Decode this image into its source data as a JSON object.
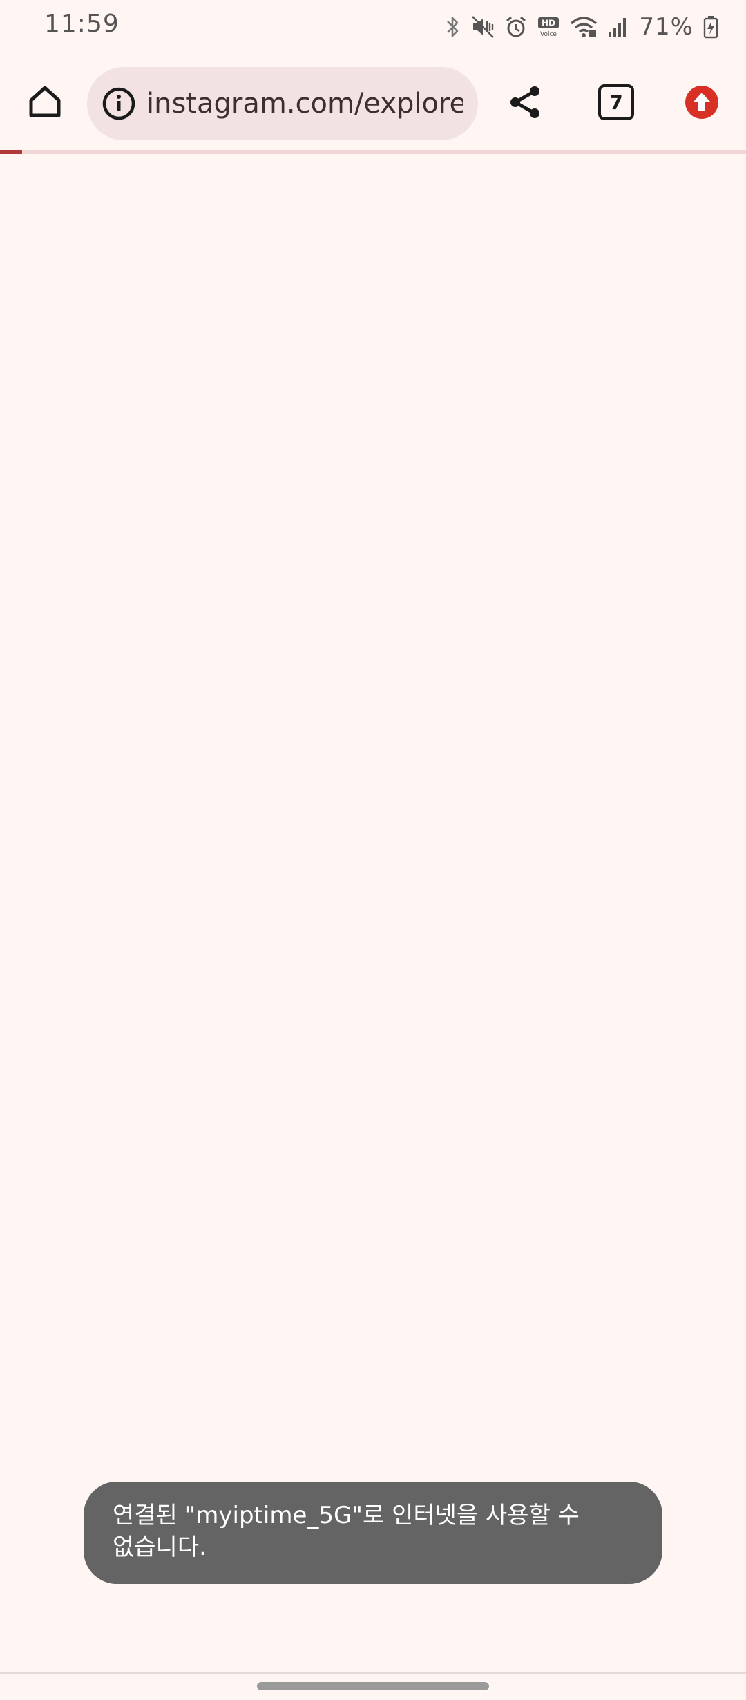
{
  "status_bar": {
    "time": "11:59",
    "battery_percent": "71%",
    "icons": [
      "bluetooth-icon",
      "mute-vibrate-icon",
      "alarm-icon",
      "hd-voice-icon",
      "wifi-icon",
      "signal-icon",
      "battery-charging-icon"
    ]
  },
  "toolbar": {
    "url": "instagram.com/explore",
    "tab_count": "7",
    "icons": [
      "home-icon",
      "site-info-icon",
      "share-icon",
      "tab-switcher-icon",
      "update-icon"
    ]
  },
  "progress": {
    "fraction": 0.03,
    "color": "#b03a3a"
  },
  "toast": {
    "line1": "연결된 \"myiptime_5G\"로 인터넷을 사용할 수",
    "line2": "없습니다."
  },
  "colors": {
    "background": "#fff6f4",
    "omnibox": "#f2e3e2",
    "toast": "#646464",
    "update_badge": "#d93025"
  }
}
